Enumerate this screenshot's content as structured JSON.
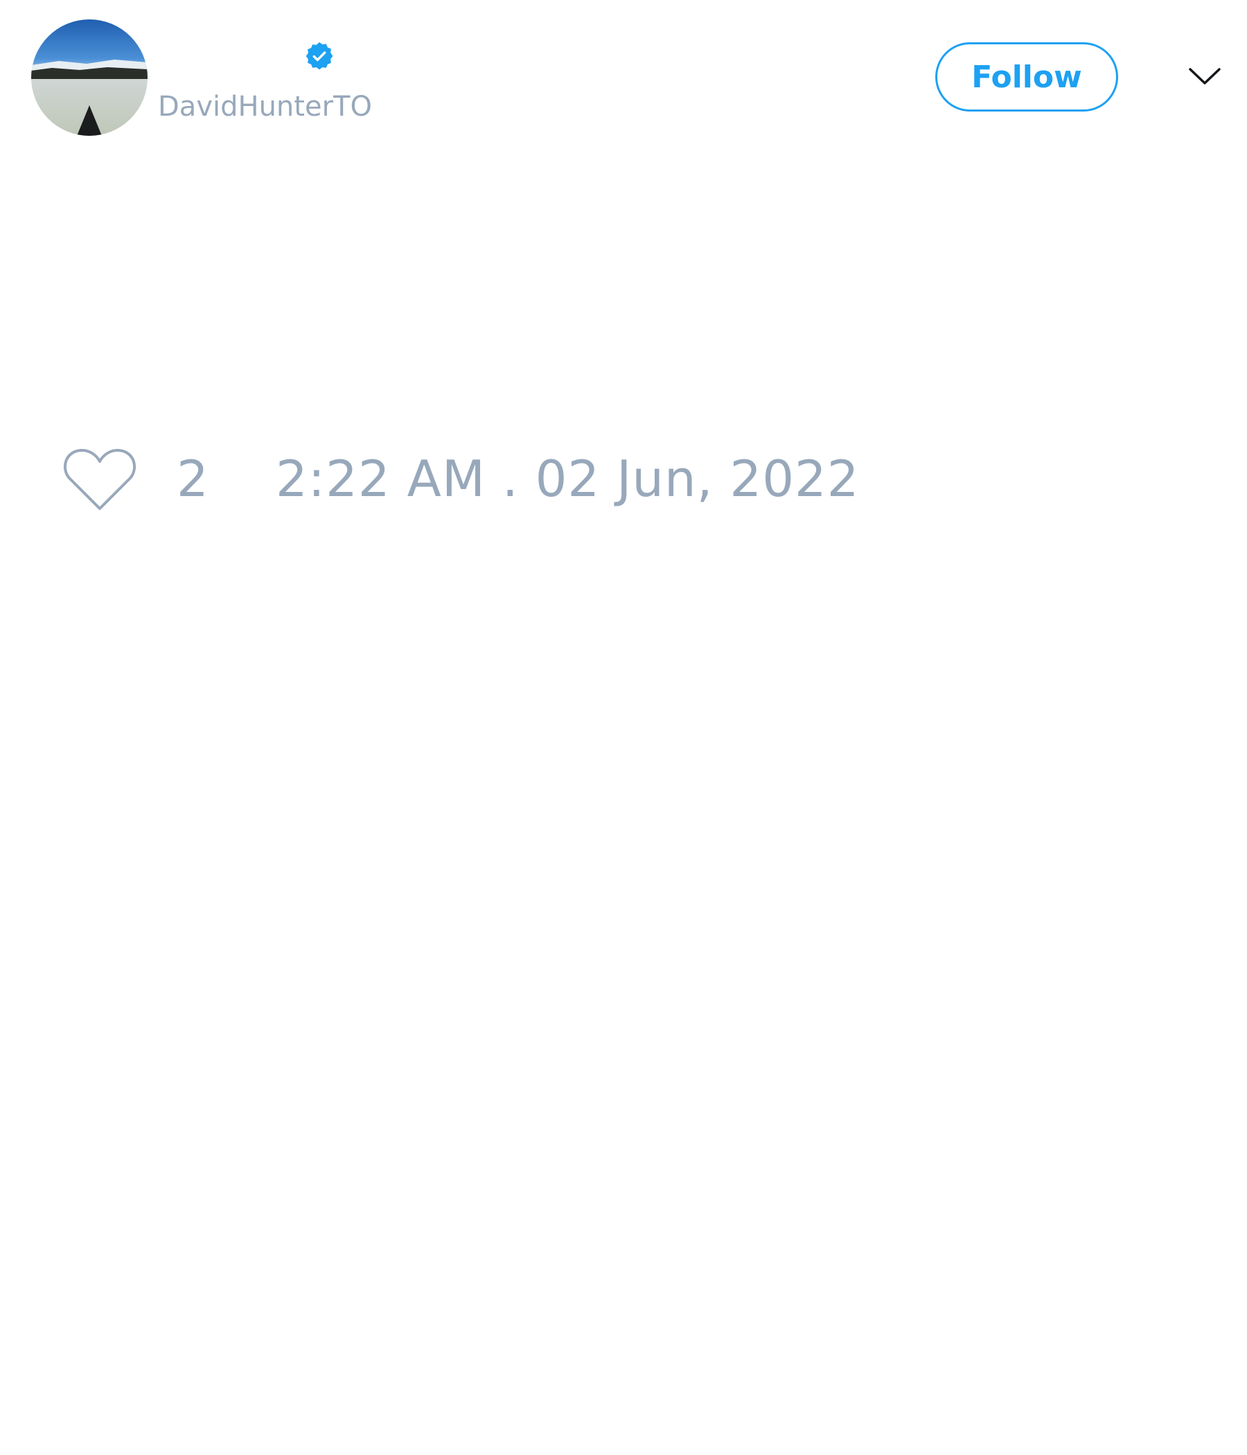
{
  "user": {
    "handle": "DavidHunterTO",
    "verified": true
  },
  "header": {
    "follow_label": "Follow",
    "menu_icon": "chevron-down-icon"
  },
  "actions": {
    "like_icon": "heart-icon",
    "like_count": "2",
    "timestamp": "2:22 AM . 02 Jun, 2022"
  },
  "colors": {
    "accent": "#1da1f2",
    "muted_text": "#98a8bb",
    "background": "#ffffff"
  }
}
